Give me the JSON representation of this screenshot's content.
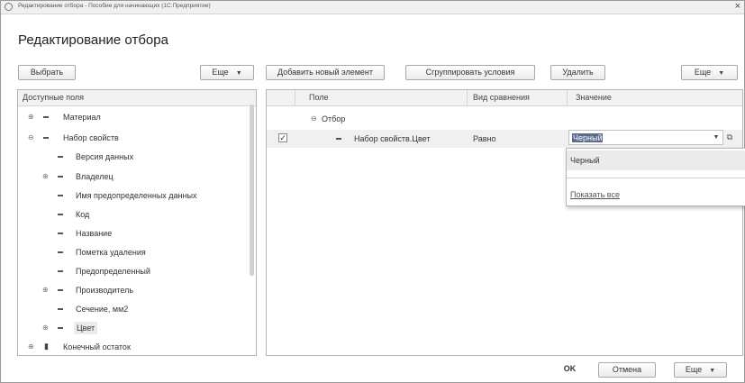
{
  "window": {
    "title": "Редактирование отбора - Пособие для начинающих (1С:Предприятие)",
    "close_glyph": "×"
  },
  "form": {
    "title": "Редактирование отбора"
  },
  "left_toolbar": {
    "select_label": "Выбрать",
    "more_label": "Еще"
  },
  "right_toolbar": {
    "add_label": "Добавить новый элемент",
    "group_label": "Сгруппировать условия",
    "delete_label": "Удалить",
    "more_label": "Еще"
  },
  "fields_tree": {
    "header": "Доступные поля",
    "items": [
      {
        "label": "Материал",
        "expander": "⊕",
        "icon": "dash-icon"
      },
      {
        "label": "Набор свойств",
        "expander": "⊖",
        "icon": "dash-icon"
      },
      {
        "label": "Версия данных",
        "icon": "dash-icon"
      },
      {
        "label": "Владелец",
        "expander": "⊕",
        "icon": "dash-icon"
      },
      {
        "label": "Имя предопределенных данных",
        "icon": "dash-icon"
      },
      {
        "label": "Код",
        "icon": "dash-icon"
      },
      {
        "label": "Название",
        "icon": "dash-icon"
      },
      {
        "label": "Пометка удаления",
        "icon": "dash-icon"
      },
      {
        "label": "Предопределенный",
        "icon": "dash-icon"
      },
      {
        "label": "Производитель",
        "expander": "⊕",
        "icon": "dash-icon"
      },
      {
        "label": "Сечение, мм2",
        "icon": "dash-icon"
      },
      {
        "label": "Цвет",
        "expander": "⊕",
        "icon": "dash-icon"
      },
      {
        "label": "Конечный остаток",
        "expander": "⊕",
        "icon": "resource-icon"
      }
    ]
  },
  "filter_table": {
    "columns": {
      "field": "Поле",
      "comparison": "Вид сравнения",
      "value": "Значение"
    },
    "group_row": {
      "expander": "⊖",
      "label": "Отбор"
    },
    "rows": [
      {
        "checked": "✓",
        "field": "Набор свойств.Цвет",
        "comparison": "Равно",
        "value": "Черный"
      }
    ]
  },
  "value_dropdown": {
    "option": "Черный",
    "show_all": "Показать все"
  },
  "footer": {
    "ok_label": "OK",
    "cancel_label": "Отмена",
    "more_label": "Еще"
  },
  "glyphs": {
    "caret": "▼",
    "lookup": "⧉"
  }
}
